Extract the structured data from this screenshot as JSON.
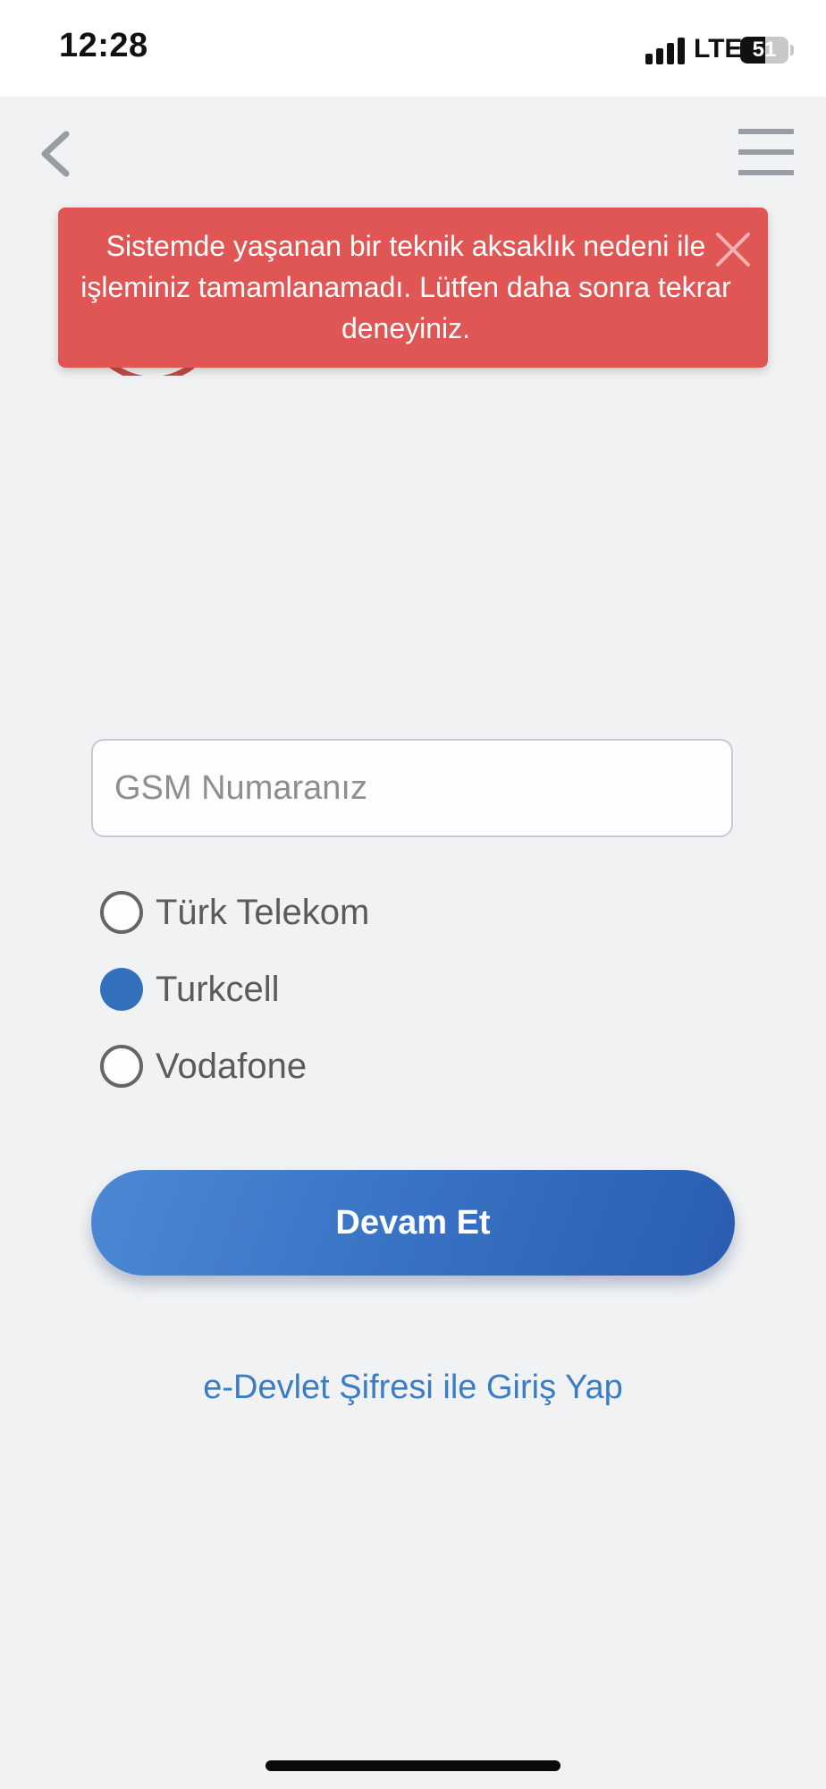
{
  "status_bar": {
    "time": "12:28",
    "network": "LTE",
    "battery_level": "51"
  },
  "toast": {
    "message": "Sistemde yaşanan bir teknik aksaklık nedeni ile işleminiz tamamlanamadı. Lütfen daha sonra tekrar deneyiniz."
  },
  "form": {
    "gsm_placeholder": "GSM Numaranız",
    "gsm_value": "",
    "operators": [
      {
        "label": "Türk Telekom",
        "selected": false
      },
      {
        "label": "Turkcell",
        "selected": true
      },
      {
        "label": "Vodafone",
        "selected": false
      }
    ],
    "continue_label": "Devam Et"
  },
  "edevlet_link": "e-Devlet Şifresi ile Giriş Yap",
  "colors": {
    "toast_bg": "#e05654",
    "accent": "#3471bd",
    "link": "#3a7cc5"
  }
}
